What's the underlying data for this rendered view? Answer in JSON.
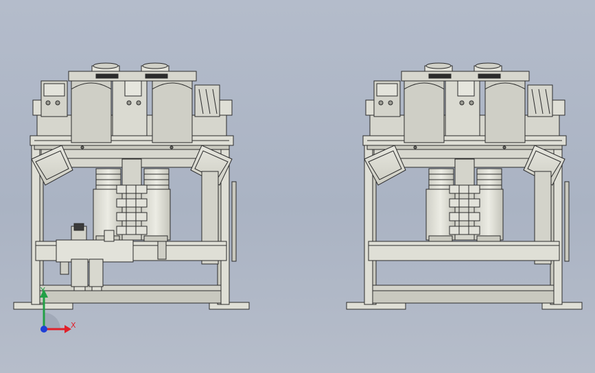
{
  "viewport": {
    "background_top": "#b4bccb",
    "background_bottom": "#b6bdca"
  },
  "model": {
    "part_fill": "#dfdfd6",
    "part_shade": "#c9c9bf",
    "edge_color": "#2b2b2b"
  },
  "triad": {
    "x_label": "X",
    "y_label": "Y",
    "x_color": "#e0202a",
    "y_color": "#22a046",
    "origin_color": "#1f3fd6"
  }
}
